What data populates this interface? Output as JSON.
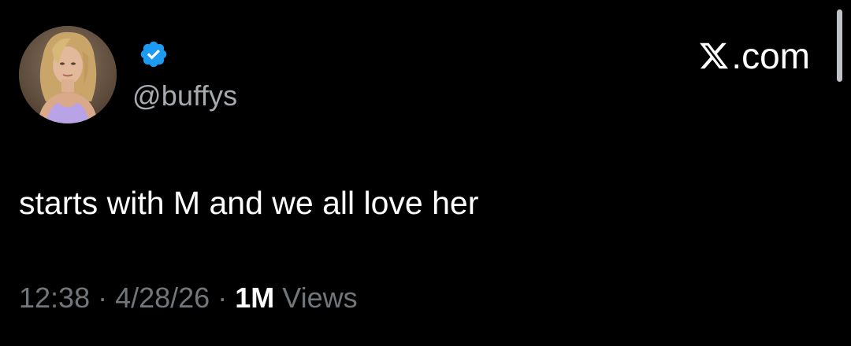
{
  "post": {
    "author": {
      "handle": "@buffys",
      "verified": true,
      "avatar_icon": "profile-photo-avatar"
    },
    "text": "starts with M and we all love her",
    "time": "12:38",
    "date": "4/28/26",
    "separator": "·",
    "views_count": "1M",
    "views_label": "Views"
  },
  "brand": {
    "suffix": ".com",
    "logo_icon": "x-logo-icon"
  },
  "colors": {
    "background": "#000000",
    "text_primary": "#ffffff",
    "text_secondary": "#71767b",
    "verified_badge": "#1d9bf0"
  }
}
